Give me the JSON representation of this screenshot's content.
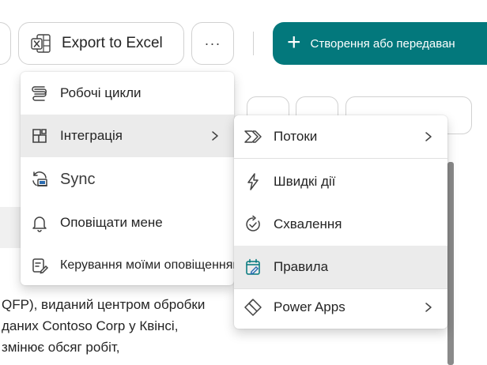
{
  "toolbar": {
    "export_label": "Export to Excel",
    "more_label": "···",
    "create_label": "Створення або передаван",
    "create_icon": "plus-icon",
    "colors": {
      "primary": "#03787c",
      "excel_green": "#107c41"
    }
  },
  "body": {
    "lines": [
      "QFP), виданий центром обробки",
      "даних Contoso Corp у Квінсі,",
      "змінює обсяг робіт,"
    ]
  },
  "main_menu": {
    "items": [
      {
        "label": "Робочі цикли",
        "icon": "workflow-icon"
      },
      {
        "label": "Інтеграція",
        "icon": "integration-icon",
        "has_submenu": true,
        "active": true
      },
      {
        "label": "Sync",
        "icon": "sync-icon"
      },
      {
        "label": "Оповіщати мене",
        "icon": "bell-icon"
      },
      {
        "label": "Керування моїми оповіщеннями",
        "icon": "manage-alerts-icon"
      }
    ]
  },
  "submenu": {
    "items": [
      {
        "label": "Потоки",
        "icon": "power-automate-icon",
        "has_submenu": true
      },
      {
        "label": "Швидкі дії",
        "icon": "lightning-icon"
      },
      {
        "label": "Схвалення",
        "icon": "approvals-icon"
      },
      {
        "label": "Правила",
        "icon": "rules-icon",
        "hovered": true
      },
      {
        "label": "Power Apps",
        "icon": "power-apps-icon",
        "has_submenu": true
      }
    ]
  }
}
